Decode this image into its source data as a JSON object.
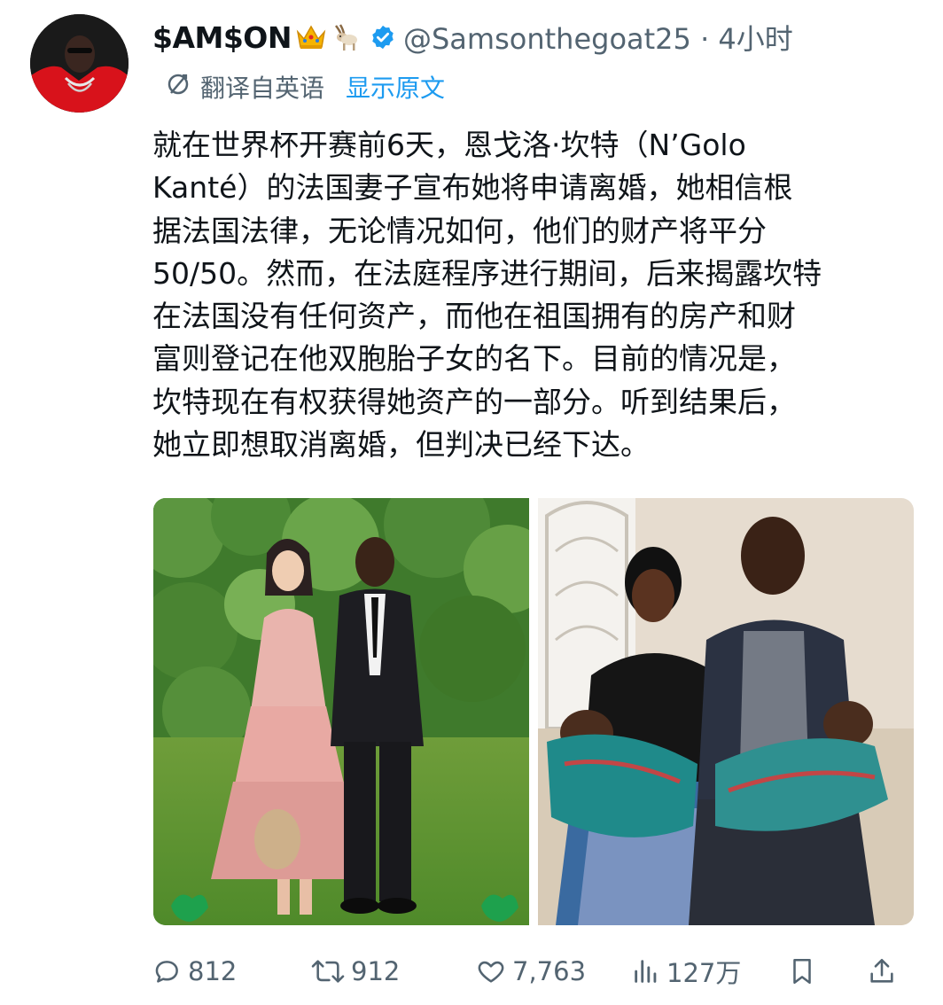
{
  "user": {
    "display_name": "$AM$ON",
    "name_emojis": [
      "crown-icon",
      "goat-icon"
    ],
    "verified": true,
    "handle_time": "@Samsonthegoat25 · 4小时"
  },
  "translation": {
    "label": "翻译自英语",
    "show_original": "显示原文"
  },
  "tweet": {
    "lines": [
      "就在世界杯开赛前6天，恩戈洛·坎特（N’Golo",
      "Kanté）的法国妻子宣布她将申请离婚，她相信根",
      "据法国法律，无论情况如何，他们的财产将平分",
      "50/50。然而，在法庭程序进行期间，后来揭露坎特",
      "在法国没有任何资产，而他在祖国拥有的房产和财",
      "富则登记在他双胞胎子女的名下。目前的情况是，",
      "坎特现在有权获得她资产的一部分。听到结果后，",
      "她立即想取消离婚，但判决已经下达。"
    ]
  },
  "actions": {
    "replies": "812",
    "retweets": "912",
    "likes": "7,763",
    "views": "127万"
  },
  "colors": {
    "text": "#0f1419",
    "secondary": "#536471",
    "link": "#1d9bf0",
    "verified": "#1d9bf0"
  }
}
